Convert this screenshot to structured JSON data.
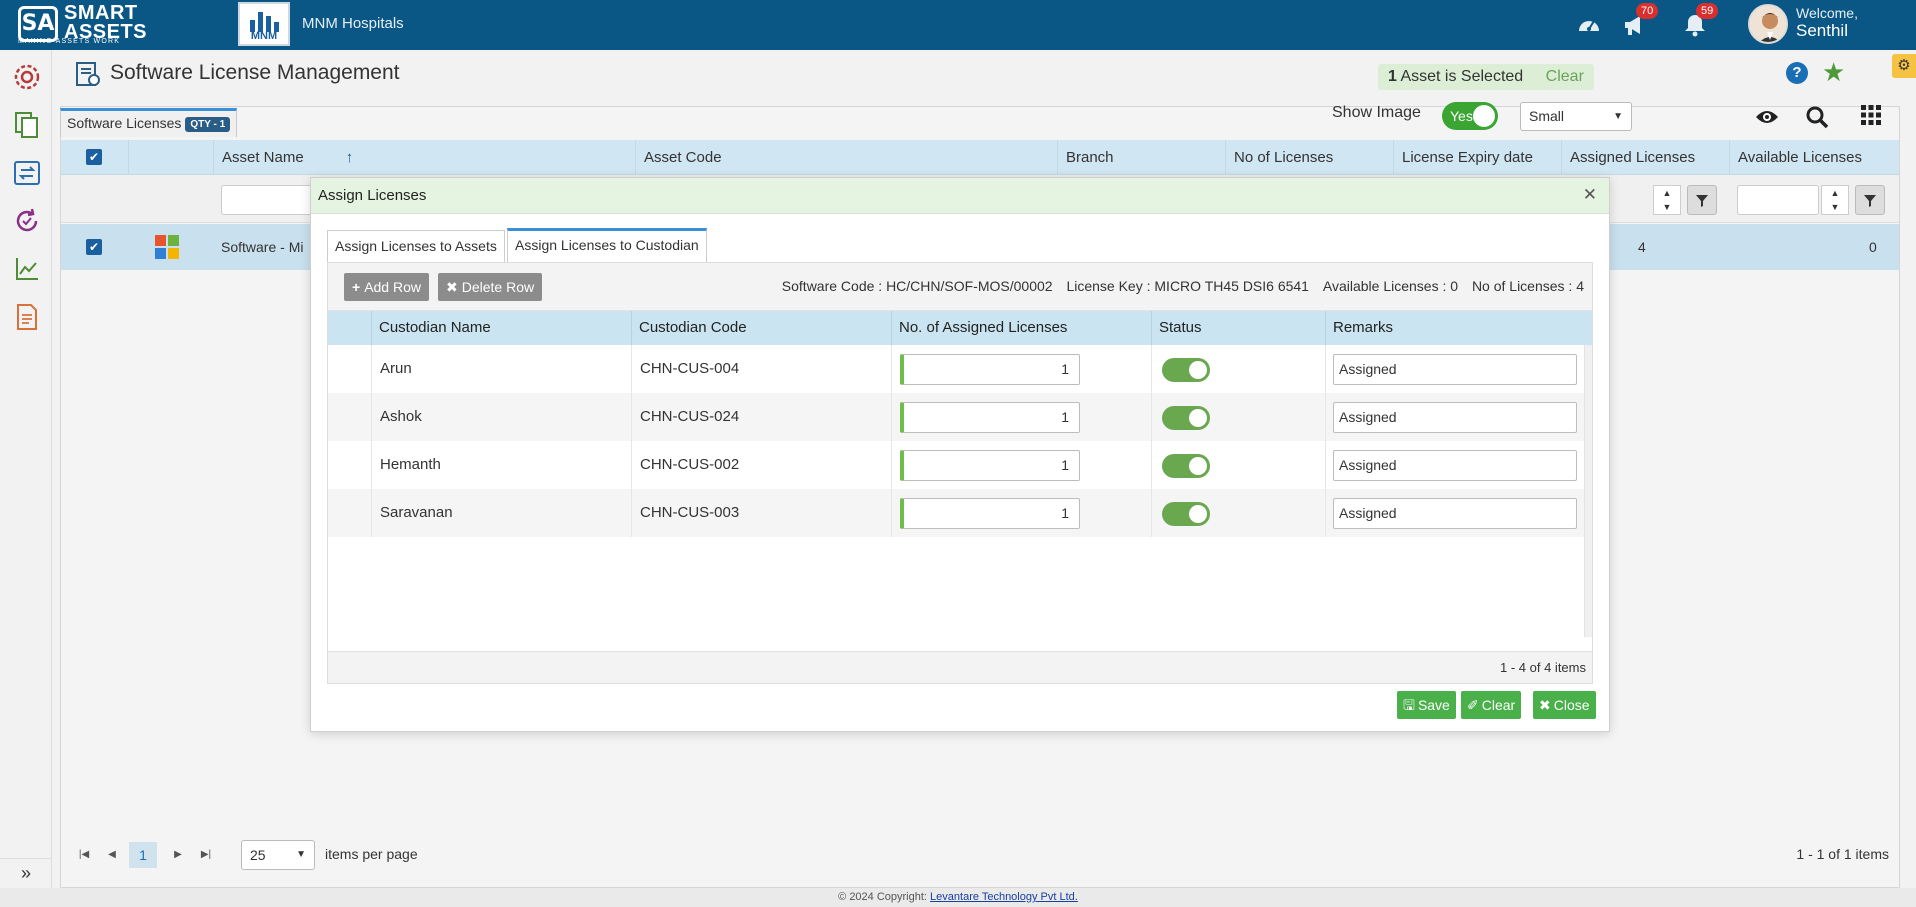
{
  "app": {
    "logo_text_line1": "SMART",
    "logo_text_line2": "ASSETS",
    "logo_tagline": "MAKING ASSETS WORK",
    "org_logo_text": "MNM",
    "org_name": "MNM Hospitals",
    "announcements_count": "70",
    "notifications_count": "59",
    "welcome": "Welcome,",
    "user_name": "Senthil"
  },
  "page": {
    "title": "Software License Management",
    "selected_count": "1",
    "selected_label": "Asset is Selected",
    "clear_label": "Clear",
    "main_tab": "Software Licenses",
    "qty_badge": "QTY - 1",
    "show_image_label": "Show Image",
    "show_image_value": "Yes",
    "image_size": "Small"
  },
  "grid": {
    "columns": [
      "Asset Name",
      "Asset Code",
      "Branch",
      "No of Licenses",
      "License Expiry date",
      "Assigned Licenses",
      "Available Licenses"
    ],
    "sort_indicator": "↑",
    "row": {
      "asset_name": "Software - Mi",
      "assigned": "4",
      "available": "0"
    },
    "pager": {
      "page": "1",
      "per_page": "25",
      "per_page_label": "items per page",
      "range": "1 - 1 of 1 items"
    }
  },
  "modal": {
    "title": "Assign Licenses",
    "tabs": [
      "Assign Licenses to Assets",
      "Assign Licenses to Custodian"
    ],
    "add_row": "Add Row",
    "delete_row": "Delete Row",
    "software_code": "Software Code : HC/CHN/SOF-MOS/00002",
    "license_key": "License Key : MICRO TH45 DSI6 6541",
    "available": "Available Licenses : 0",
    "total": "No of Licenses : 4",
    "columns": [
      "Custodian Name",
      "Custodian Code",
      "No. of Assigned Licenses",
      "Status",
      "Remarks"
    ],
    "rows": [
      {
        "name": "Arun",
        "code": "CHN-CUS-004",
        "qty": "1",
        "remarks": "Assigned"
      },
      {
        "name": "Ashok",
        "code": "CHN-CUS-024",
        "qty": "1",
        "remarks": "Assigned"
      },
      {
        "name": "Hemanth",
        "code": "CHN-CUS-002",
        "qty": "1",
        "remarks": "Assigned"
      },
      {
        "name": "Saravanan",
        "code": "CHN-CUS-003",
        "qty": "1",
        "remarks": "Assigned"
      }
    ],
    "range": "1 - 4 of 4 items",
    "save": "Save",
    "clear": "Clear",
    "close": "Close"
  },
  "footer": {
    "copyright": "© 2024 Copyright:",
    "company": "Levantare Technology Pvt Ltd."
  },
  "colors": {
    "topbar": "#0a5786",
    "header_row": "#d0e6f2",
    "modal_header": "#e5f3e1",
    "action_green": "#49b04a"
  }
}
